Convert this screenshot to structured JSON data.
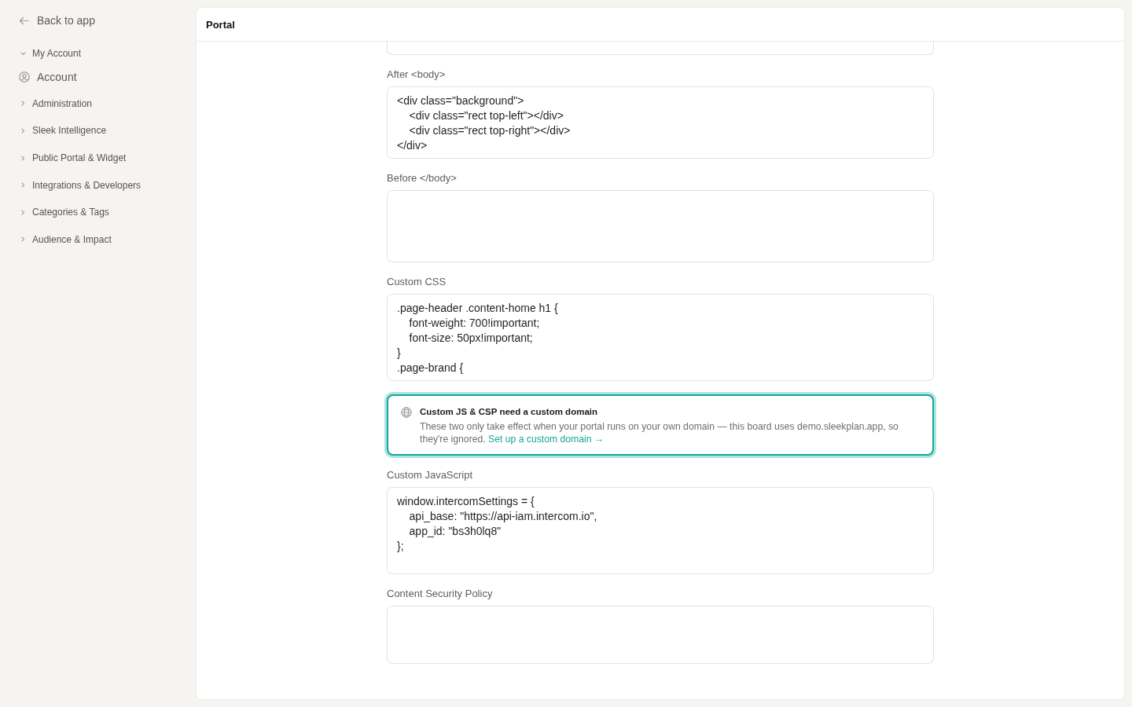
{
  "sidebar": {
    "back_link": "Back to app",
    "groups": [
      {
        "label": "My Account",
        "expanded": true,
        "items": [
          {
            "label": "Account",
            "selected": false
          }
        ]
      },
      {
        "label": "Administration",
        "expanded": false
      },
      {
        "label": "Sleek Intelligence",
        "expanded": false
      },
      {
        "label": "Public Portal & Widget",
        "expanded": false
      },
      {
        "label": "Integrations & Developers",
        "expanded": false
      },
      {
        "label": "Categories & Tags",
        "expanded": false
      },
      {
        "label": "Audience & Impact",
        "expanded": false
      }
    ]
  },
  "panel": {
    "title": "Portal",
    "fields": [
      {
        "kind": "textarea",
        "clipped": true
      },
      {
        "kind": "textarea",
        "clipped": false,
        "label": "After <body>",
        "value": "<div class=\"background\">\n    <div class=\"rect top-left\"></div>\n    <div class=\"rect top-right\"></div>\n</div>"
      },
      {
        "kind": "textarea",
        "clipped": false,
        "label": "Before </body>"
      },
      {
        "kind": "textarea",
        "clipped": false,
        "label": "Custom CSS",
        "value": ".page-header .content-home h1 {\n    font-weight: 700!important;\n    font-size: 50px!important;\n}\n.page-brand {"
      },
      {
        "kind": "notice",
        "title": "Custom JS & CSP need a custom domain",
        "text": "These two only take effect when your portal runs on your own domain — this board uses demo.sleekplan.app, so they're ignored.",
        "link": "Set up a custom domain →"
      },
      {
        "kind": "textarea",
        "clipped": false,
        "label": "Custom JavaScript",
        "value": "window.intercomSettings = {\n    api_base: \"https://api-iam.intercom.io\",\n    app_id: \"bs3h0lq8\"\n};"
      },
      {
        "kind": "textarea",
        "clipped": false,
        "label": "Content Security Policy"
      }
    ]
  }
}
